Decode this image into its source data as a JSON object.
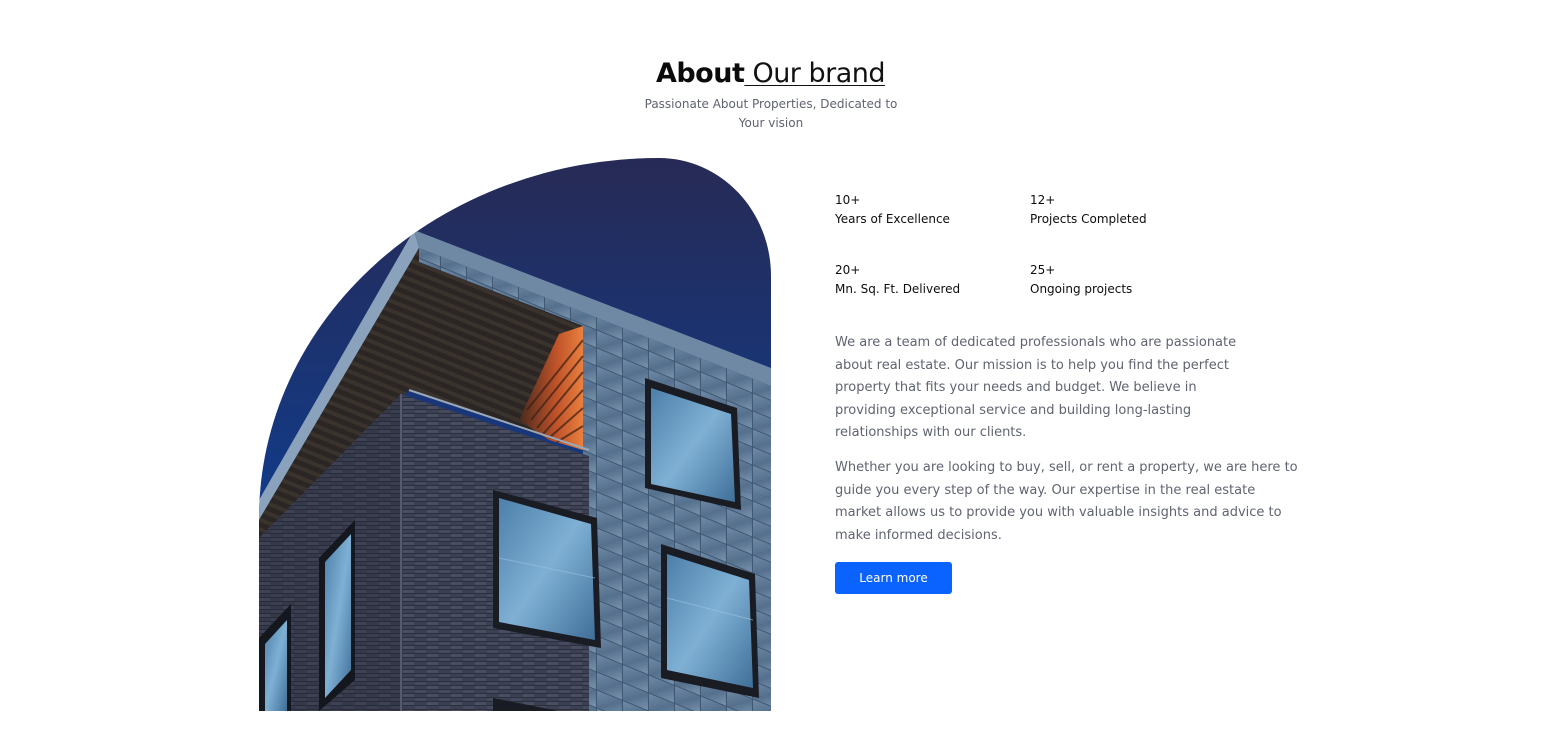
{
  "heading": {
    "bold": "About",
    "light": " Our brand"
  },
  "subtitle": {
    "line1": "Passionate About Properties, Dedicated to",
    "line2": "Your vision"
  },
  "image": {
    "subject": "modern-building-photo",
    "colors": {
      "sky_top": "#272a55",
      "sky_bottom": "#0d4a9c",
      "brick": "#3d4154",
      "cladding": "#5e7a94"
    }
  },
  "stats": [
    {
      "value": "10+",
      "label": "Years of Excellence"
    },
    {
      "value": "12+",
      "label": "Projects Completed"
    },
    {
      "value": "20+",
      "label": "Mn. Sq. Ft. Delivered"
    },
    {
      "value": "25+",
      "label": "Ongoing projects"
    }
  ],
  "paragraph1": [
    "We are a team of dedicated professionals who are passionate",
    "about real estate. Our mission is to help you find the perfect",
    "property that fits your needs and budget. We believe in",
    "providing exceptional service and building long-lasting",
    "relationships with our clients."
  ],
  "paragraph2": [
    "Whether you are looking to buy, sell, or rent a property, we are here to",
    "guide you every step of the way. Our expertise in the real estate",
    "market allows us to provide you with valuable insights and advice to",
    "make informed decisions."
  ],
  "cta": {
    "label": "Learn more",
    "color": "#0a63ff"
  }
}
